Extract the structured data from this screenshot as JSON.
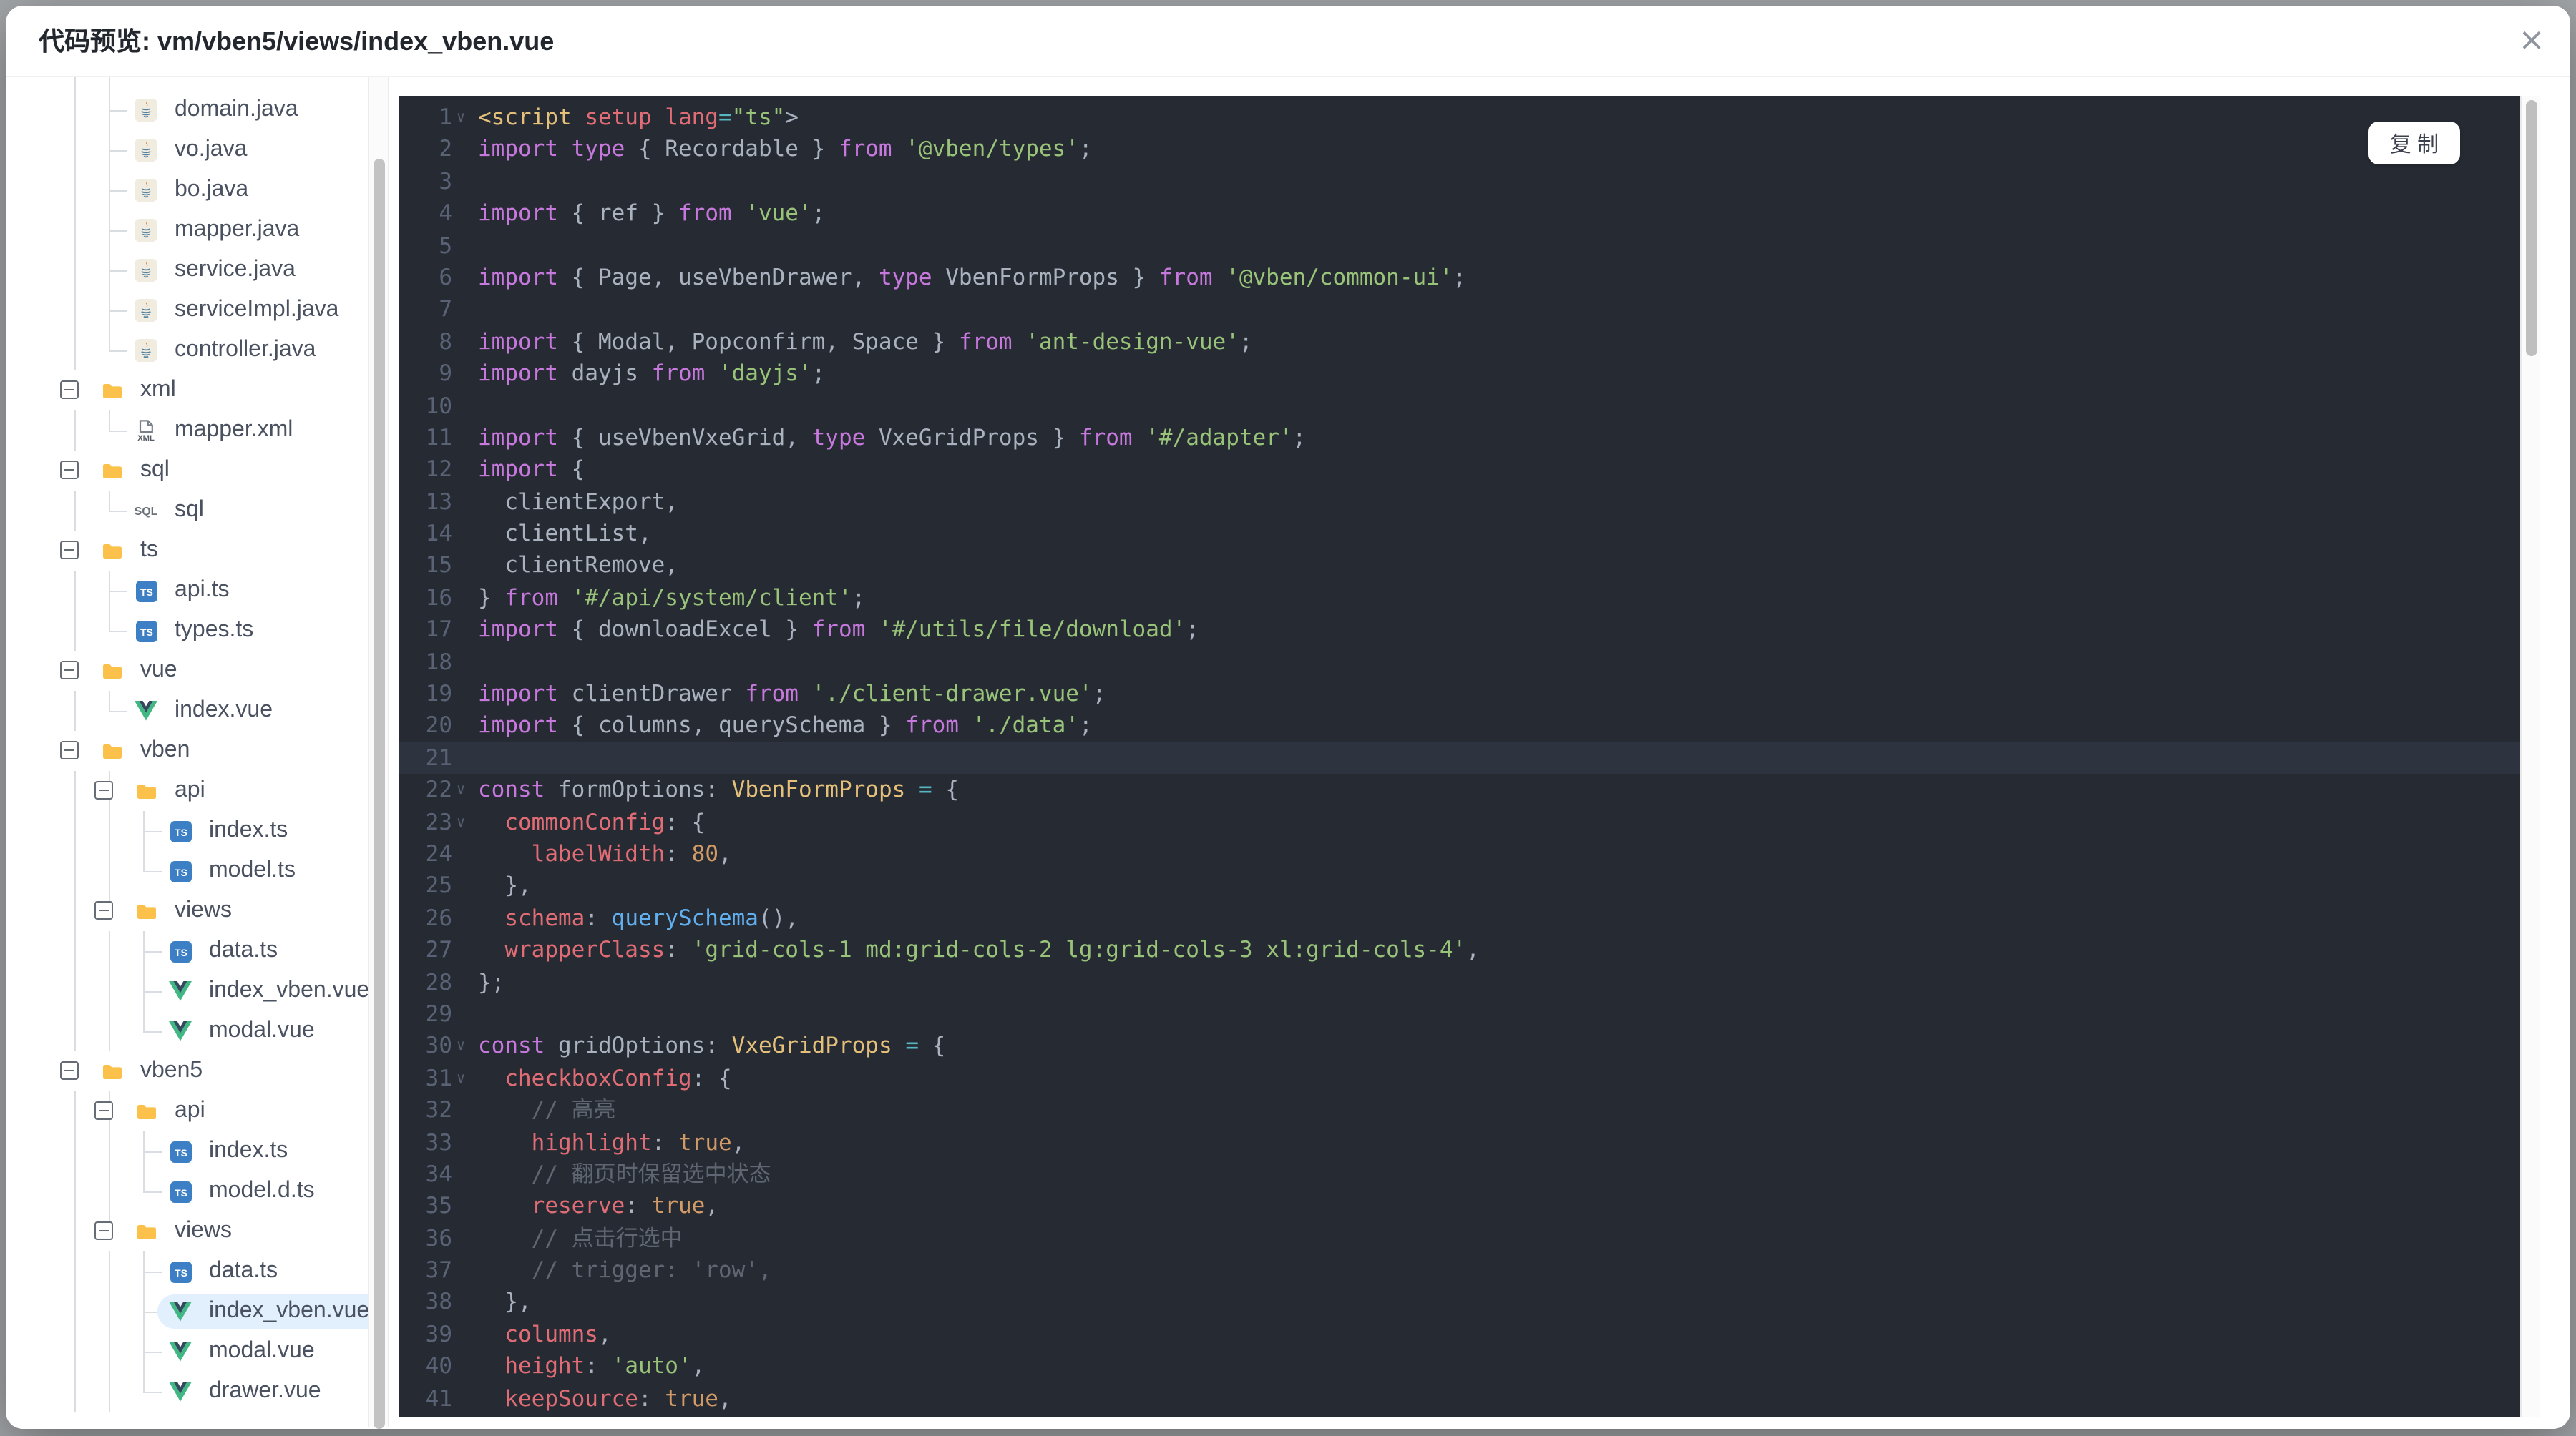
{
  "dialog": {
    "title": "代码预览: vm/vben5/views/index_vben.vue",
    "close_icon": "×"
  },
  "copy_button": {
    "label": "复 制"
  },
  "colors": {
    "selection_bg": "#e2f0fd",
    "folder": "#fbc14b",
    "ts_badge": "#3d7fc4",
    "vue_green": "#41b883",
    "vue_dark": "#35495e",
    "code_tokens": {
      "kw": "#c678dd",
      "pl": "#abb2bf",
      "st": "#98c379",
      "pr": "#e06c75",
      "nu": "#d19a66",
      "fn": "#61afef",
      "ty": "#e5c07b",
      "cm": "#5f6672",
      "op": "#56b6c2"
    }
  },
  "tree": {
    "rows": [
      {
        "label": "domain.java",
        "icon": "java-file-icon",
        "type": "file",
        "depth": 1,
        "last": false
      },
      {
        "label": "vo.java",
        "icon": "java-file-icon",
        "type": "file",
        "depth": 1,
        "last": false
      },
      {
        "label": "bo.java",
        "icon": "java-file-icon",
        "type": "file",
        "depth": 1,
        "last": false
      },
      {
        "label": "mapper.java",
        "icon": "java-file-icon",
        "type": "file",
        "depth": 1,
        "last": false
      },
      {
        "label": "service.java",
        "icon": "java-file-icon",
        "type": "file",
        "depth": 1,
        "last": false
      },
      {
        "label": "serviceImpl.java",
        "icon": "java-file-icon",
        "type": "file",
        "depth": 1,
        "last": false
      },
      {
        "label": "controller.java",
        "icon": "java-file-icon",
        "type": "file",
        "depth": 1,
        "last": true
      },
      {
        "label": "xml",
        "icon": "folder-icon",
        "type": "folder",
        "depth": 0,
        "expanded": true
      },
      {
        "label": "mapper.xml",
        "icon": "xml-file-icon",
        "type": "file",
        "depth": 1,
        "last": true
      },
      {
        "label": "sql",
        "icon": "folder-icon",
        "type": "folder",
        "depth": 0,
        "expanded": true
      },
      {
        "label": "sql",
        "icon": "sql-file-icon",
        "type": "file",
        "depth": 1,
        "last": true
      },
      {
        "label": "ts",
        "icon": "folder-icon",
        "type": "folder",
        "depth": 0,
        "expanded": true
      },
      {
        "label": "api.ts",
        "icon": "ts-file-icon",
        "type": "file",
        "depth": 1,
        "last": false
      },
      {
        "label": "types.ts",
        "icon": "ts-file-icon",
        "type": "file",
        "depth": 1,
        "last": true
      },
      {
        "label": "vue",
        "icon": "folder-icon",
        "type": "folder",
        "depth": 0,
        "expanded": true
      },
      {
        "label": "index.vue",
        "icon": "vue-file-icon",
        "type": "file",
        "depth": 1,
        "last": true
      },
      {
        "label": "vben",
        "icon": "folder-icon",
        "type": "folder",
        "depth": 0,
        "expanded": true
      },
      {
        "label": "api",
        "icon": "folder-icon",
        "type": "folder",
        "depth": 1,
        "expanded": true,
        "last": false
      },
      {
        "label": "index.ts",
        "icon": "ts-file-icon",
        "type": "file",
        "depth": 2,
        "last": false
      },
      {
        "label": "model.ts",
        "icon": "ts-file-icon",
        "type": "file",
        "depth": 2,
        "last": true
      },
      {
        "label": "views",
        "icon": "folder-icon",
        "type": "folder",
        "depth": 1,
        "expanded": true,
        "last": true
      },
      {
        "label": "data.ts",
        "icon": "ts-file-icon",
        "type": "file",
        "depth": 2,
        "last": false
      },
      {
        "label": "index_vben.vue",
        "icon": "vue-file-icon",
        "type": "file",
        "depth": 2,
        "last": false
      },
      {
        "label": "modal.vue",
        "icon": "vue-file-icon",
        "type": "file",
        "depth": 2,
        "last": true
      },
      {
        "label": "vben5",
        "icon": "folder-icon",
        "type": "folder",
        "depth": 0,
        "expanded": true
      },
      {
        "label": "api",
        "icon": "folder-icon",
        "type": "folder",
        "depth": 1,
        "expanded": true,
        "last": false
      },
      {
        "label": "index.ts",
        "icon": "ts-file-icon",
        "type": "file",
        "depth": 2,
        "last": false
      },
      {
        "label": "model.d.ts",
        "icon": "ts-file-icon",
        "type": "file",
        "depth": 2,
        "last": true
      },
      {
        "label": "views",
        "icon": "folder-icon",
        "type": "folder",
        "depth": 1,
        "expanded": true,
        "last": true
      },
      {
        "label": "data.ts",
        "icon": "ts-file-icon",
        "type": "file",
        "depth": 2,
        "last": false
      },
      {
        "label": "index_vben.vue",
        "icon": "vue-file-icon",
        "type": "file",
        "depth": 2,
        "last": false,
        "selected": true
      },
      {
        "label": "modal.vue",
        "icon": "vue-file-icon",
        "type": "file",
        "depth": 2,
        "last": false
      },
      {
        "label": "drawer.vue",
        "icon": "vue-file-icon",
        "type": "file",
        "depth": 2,
        "last": true
      }
    ]
  },
  "code": {
    "lines": [
      {
        "n": 1,
        "fold": true,
        "tokens": [
          [
            "ty",
            "<script"
          ],
          [
            "pr",
            " setup lang"
          ],
          [
            "op",
            "="
          ],
          [
            "st",
            "\"ts\""
          ],
          [
            "pl",
            ">"
          ]
        ]
      },
      {
        "n": 2,
        "tokens": [
          [
            "kw",
            "import type"
          ],
          [
            "pl",
            " { Recordable } "
          ],
          [
            "kw",
            "from"
          ],
          [
            "st",
            " '@vben/types'"
          ],
          [
            "pl",
            ";"
          ]
        ]
      },
      {
        "n": 3,
        "tokens": []
      },
      {
        "n": 4,
        "tokens": [
          [
            "kw",
            "import"
          ],
          [
            "pl",
            " { ref } "
          ],
          [
            "kw",
            "from"
          ],
          [
            "st",
            " 'vue'"
          ],
          [
            "pl",
            ";"
          ]
        ]
      },
      {
        "n": 5,
        "tokens": []
      },
      {
        "n": 6,
        "tokens": [
          [
            "kw",
            "import"
          ],
          [
            "pl",
            " { Page, useVbenDrawer, "
          ],
          [
            "kw",
            "type"
          ],
          [
            "pl",
            " VbenFormProps } "
          ],
          [
            "kw",
            "from"
          ],
          [
            "st",
            " '@vben/common-ui'"
          ],
          [
            "pl",
            ";"
          ]
        ]
      },
      {
        "n": 7,
        "tokens": []
      },
      {
        "n": 8,
        "tokens": [
          [
            "kw",
            "import"
          ],
          [
            "pl",
            " { Modal, Popconfirm, Space } "
          ],
          [
            "kw",
            "from"
          ],
          [
            "st",
            " 'ant-design-vue'"
          ],
          [
            "pl",
            ";"
          ]
        ]
      },
      {
        "n": 9,
        "tokens": [
          [
            "kw",
            "import"
          ],
          [
            "pl",
            " dayjs "
          ],
          [
            "kw",
            "from"
          ],
          [
            "st",
            " 'dayjs'"
          ],
          [
            "pl",
            ";"
          ]
        ]
      },
      {
        "n": 10,
        "tokens": []
      },
      {
        "n": 11,
        "tokens": [
          [
            "kw",
            "import"
          ],
          [
            "pl",
            " { useVbenVxeGrid, "
          ],
          [
            "kw",
            "type"
          ],
          [
            "pl",
            " VxeGridProps } "
          ],
          [
            "kw",
            "from"
          ],
          [
            "st",
            " '#/adapter'"
          ],
          [
            "pl",
            ";"
          ]
        ]
      },
      {
        "n": 12,
        "tokens": [
          [
            "kw",
            "import"
          ],
          [
            "pl",
            " {"
          ]
        ]
      },
      {
        "n": 13,
        "tokens": [
          [
            "pl",
            "  clientExport,"
          ]
        ]
      },
      {
        "n": 14,
        "tokens": [
          [
            "pl",
            "  clientList,"
          ]
        ]
      },
      {
        "n": 15,
        "tokens": [
          [
            "pl",
            "  clientRemove,"
          ]
        ]
      },
      {
        "n": 16,
        "tokens": [
          [
            "pl",
            "} "
          ],
          [
            "kw",
            "from"
          ],
          [
            "st",
            " '#/api/system/client'"
          ],
          [
            "pl",
            ";"
          ]
        ]
      },
      {
        "n": 17,
        "tokens": [
          [
            "kw",
            "import"
          ],
          [
            "pl",
            " { downloadExcel } "
          ],
          [
            "kw",
            "from"
          ],
          [
            "st",
            " '#/utils/file/download'"
          ],
          [
            "pl",
            ";"
          ]
        ]
      },
      {
        "n": 18,
        "tokens": []
      },
      {
        "n": 19,
        "tokens": [
          [
            "kw",
            "import"
          ],
          [
            "pl",
            " clientDrawer "
          ],
          [
            "kw",
            "from"
          ],
          [
            "st",
            " './client-drawer.vue'"
          ],
          [
            "pl",
            ";"
          ]
        ]
      },
      {
        "n": 20,
        "tokens": [
          [
            "kw",
            "import"
          ],
          [
            "pl",
            " { columns, querySchema } "
          ],
          [
            "kw",
            "from"
          ],
          [
            "st",
            " './data'"
          ],
          [
            "pl",
            ";"
          ]
        ]
      },
      {
        "n": 21,
        "active": true,
        "tokens": []
      },
      {
        "n": 22,
        "fold": true,
        "tokens": [
          [
            "kw",
            "const"
          ],
          [
            "pl",
            " formOptions: "
          ],
          [
            "ty",
            "VbenFormProps"
          ],
          [
            "pl",
            " "
          ],
          [
            "op",
            "="
          ],
          [
            "pl",
            " {"
          ]
        ]
      },
      {
        "n": 23,
        "fold": true,
        "tokens": [
          [
            "pr",
            "  commonConfig"
          ],
          [
            "pl",
            ": {"
          ]
        ]
      },
      {
        "n": 24,
        "tokens": [
          [
            "pr",
            "    labelWidth"
          ],
          [
            "pl",
            ": "
          ],
          [
            "nu",
            "80"
          ],
          [
            "pl",
            ","
          ]
        ]
      },
      {
        "n": 25,
        "tokens": [
          [
            "pl",
            "  },"
          ]
        ]
      },
      {
        "n": 26,
        "tokens": [
          [
            "pr",
            "  schema"
          ],
          [
            "pl",
            ": "
          ],
          [
            "fn",
            "querySchema"
          ],
          [
            "pl",
            "(),"
          ]
        ]
      },
      {
        "n": 27,
        "tokens": [
          [
            "pr",
            "  wrapperClass"
          ],
          [
            "pl",
            ": "
          ],
          [
            "st",
            "'grid-cols-1 md:grid-cols-2 lg:grid-cols-3 xl:grid-cols-4'"
          ],
          [
            "pl",
            ","
          ]
        ]
      },
      {
        "n": 28,
        "tokens": [
          [
            "pl",
            "};"
          ]
        ]
      },
      {
        "n": 29,
        "tokens": []
      },
      {
        "n": 30,
        "fold": true,
        "tokens": [
          [
            "kw",
            "const"
          ],
          [
            "pl",
            " gridOptions: "
          ],
          [
            "ty",
            "VxeGridProps"
          ],
          [
            "pl",
            " "
          ],
          [
            "op",
            "="
          ],
          [
            "pl",
            " {"
          ]
        ]
      },
      {
        "n": 31,
        "fold": true,
        "tokens": [
          [
            "pr",
            "  checkboxConfig"
          ],
          [
            "pl",
            ": {"
          ]
        ]
      },
      {
        "n": 32,
        "tokens": [
          [
            "cm",
            "    // 高亮"
          ]
        ]
      },
      {
        "n": 33,
        "tokens": [
          [
            "pr",
            "    highlight"
          ],
          [
            "pl",
            ": "
          ],
          [
            "nu",
            "true"
          ],
          [
            "pl",
            ","
          ]
        ]
      },
      {
        "n": 34,
        "tokens": [
          [
            "cm",
            "    // 翻页时保留选中状态"
          ]
        ]
      },
      {
        "n": 35,
        "tokens": [
          [
            "pr",
            "    reserve"
          ],
          [
            "pl",
            ": "
          ],
          [
            "nu",
            "true"
          ],
          [
            "pl",
            ","
          ]
        ]
      },
      {
        "n": 36,
        "tokens": [
          [
            "cm",
            "    // 点击行选中"
          ]
        ]
      },
      {
        "n": 37,
        "tokens": [
          [
            "cm",
            "    // trigger: 'row',"
          ]
        ]
      },
      {
        "n": 38,
        "tokens": [
          [
            "pl",
            "  },"
          ]
        ]
      },
      {
        "n": 39,
        "tokens": [
          [
            "pr",
            "  columns"
          ],
          [
            "pl",
            ","
          ]
        ]
      },
      {
        "n": 40,
        "tokens": [
          [
            "pr",
            "  height"
          ],
          [
            "pl",
            ": "
          ],
          [
            "st",
            "'auto'"
          ],
          [
            "pl",
            ","
          ]
        ]
      },
      {
        "n": 41,
        "tokens": [
          [
            "pr",
            "  keepSource"
          ],
          [
            "pl",
            ": "
          ],
          [
            "nu",
            "true"
          ],
          [
            "pl",
            ","
          ]
        ]
      }
    ]
  }
}
